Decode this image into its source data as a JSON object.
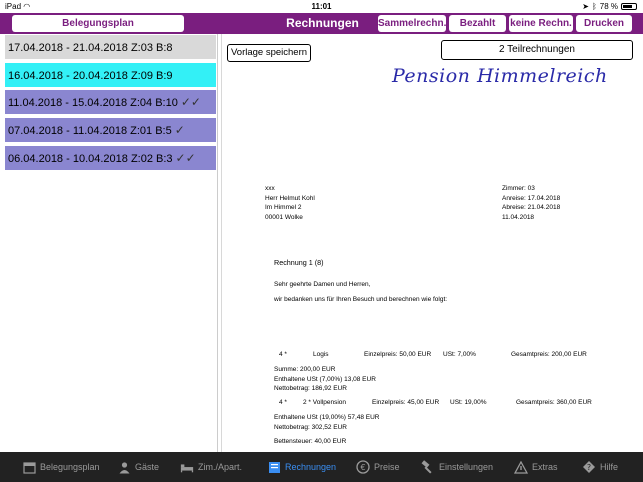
{
  "status": {
    "device": "iPad",
    "time": "11:01",
    "battery": "78 %",
    "battery_level": 0.78
  },
  "nav": {
    "belegungsplan": "Belegungsplan",
    "title": "Rechnungen",
    "sammelrechn": "Sammelrechn.",
    "bezahlt": "Bezahlt",
    "keine_rechn": "keine Rechn.",
    "drucken": "Drucken"
  },
  "list": [
    {
      "text": "17.04.2018 - 21.04.2018 Z:03 B:8",
      "bg": "#d9d9d9",
      "checks": ""
    },
    {
      "text": "16.04.2018 - 20.04.2018 Z:09 B:9",
      "bg": "#33f0f6",
      "checks": ""
    },
    {
      "text": "11.04.2018 - 15.04.2018 Z:04 B:10",
      "bg": "#8a86d0",
      "checks": "✓✓"
    },
    {
      "text": "07.04.2018 - 11.04.2018 Z:01 B:5",
      "bg": "#8a86d0",
      "checks": "✓"
    },
    {
      "text": "06.04.2018 - 10.04.2018 Z:02 B:3",
      "bg": "#8a86d0",
      "checks": "✓✓"
    }
  ],
  "doc": {
    "vorlage": "Vorlage speichern",
    "teilrechnungen": "2 Teilrechnungen",
    "logo": "Pension Himmelreich",
    "addr": [
      "xxx",
      "Herr Helmut Kohl",
      "Im Himmel 2",
      "00001 Wolke"
    ],
    "info": [
      "Zimmer: 03",
      "Anreise: 17.04.2018",
      "Abreise: 21.04.2018",
      "11.04.2018"
    ],
    "rechnung": "Rechnung  1 (8)",
    "greeting": "Sehr geehrte Damen und Herren,",
    "intro": "wir bedanken uns für Ihren Besuch und berechnen wie folgt:",
    "line1": {
      "qty": "4   *",
      "item": "Logis",
      "einzel": "Einzelpreis: 50,00 EUR",
      "ust": "USt: 7,00%",
      "gesamt": "Gesamtpreis: 200,00 EUR"
    },
    "sum1": [
      "Summe:  200,00 EUR",
      "Enthaltene USt (7,00%)   13,08 EUR",
      "Nettobetrag: 186,92 EUR"
    ],
    "line2": {
      "qty": "4   *",
      "item": "2 * Vollpension",
      "einzel": "Einzelpreis: 45,00 EUR",
      "ust": "USt: 19,00%",
      "gesamt": "Gesamtpreis: 360,00 EUR"
    },
    "sum2": [
      "Enthaltene USt (19,00%)   57,48 EUR",
      "Nettobetrag: 302,52 EUR"
    ],
    "bettensteuer": "Bettensteuer:          40,00 EUR"
  },
  "tabs": [
    {
      "label": "Belegungsplan",
      "icon": "calendar-icon"
    },
    {
      "label": "Gäste",
      "icon": "guest-icon"
    },
    {
      "label": "Zim./Apart.",
      "icon": "bed-icon"
    },
    {
      "label": "Rechnungen",
      "icon": "invoice-icon"
    },
    {
      "label": "Preise",
      "icon": "euro-icon"
    },
    {
      "label": "Einstellungen",
      "icon": "hammer-icon"
    },
    {
      "label": "Extras",
      "icon": "extras-icon"
    },
    {
      "label": "Hilfe",
      "icon": "help-icon"
    }
  ],
  "colors": {
    "accent": "#7a1e7f",
    "active_tab": "#3a8ef2"
  }
}
